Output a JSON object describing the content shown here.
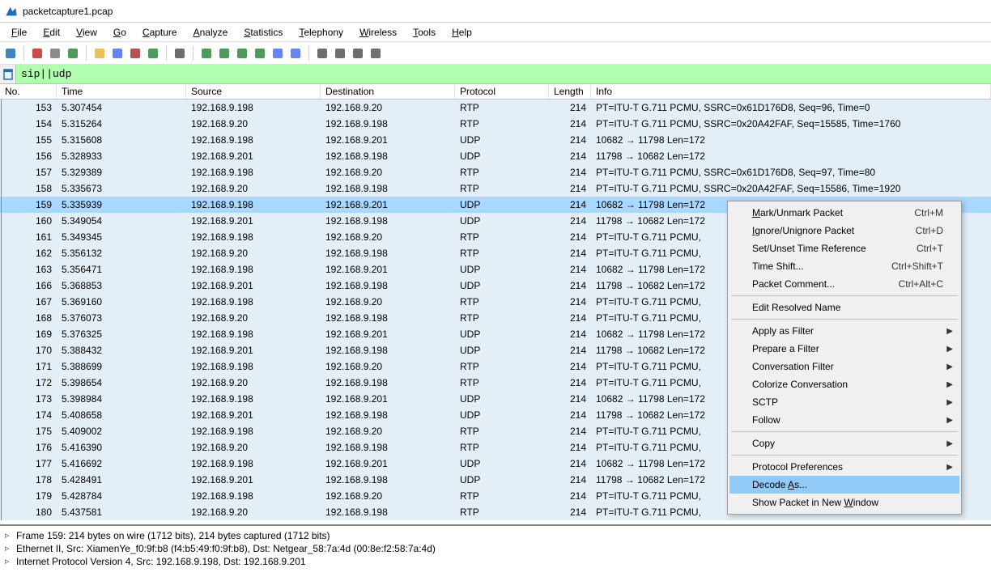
{
  "window": {
    "title": "packetcapture1.pcap"
  },
  "menu": {
    "items": [
      "File",
      "Edit",
      "View",
      "Go",
      "Capture",
      "Analyze",
      "Statistics",
      "Telephony",
      "Wireless",
      "Tools",
      "Help"
    ]
  },
  "filter": {
    "value": "sip||udp"
  },
  "columns": {
    "no": "No.",
    "time": "Time",
    "src": "Source",
    "dst": "Destination",
    "proto": "Protocol",
    "len": "Length",
    "info": "Info"
  },
  "packets": [
    {
      "no": "153",
      "time": "5.307454",
      "src": "192.168.9.198",
      "dst": "192.168.9.20",
      "proto": "RTP",
      "len": "214",
      "info": "PT=ITU-T G.711 PCMU, SSRC=0x61D176D8, Seq=96, Time=0",
      "bg": "#e4eef7"
    },
    {
      "no": "154",
      "time": "5.315264",
      "src": "192.168.9.20",
      "dst": "192.168.9.198",
      "proto": "RTP",
      "len": "214",
      "info": "PT=ITU-T G.711 PCMU, SSRC=0x20A42FAF, Seq=15585, Time=1760",
      "bg": "#e4eef7"
    },
    {
      "no": "155",
      "time": "5.315608",
      "src": "192.168.9.198",
      "dst": "192.168.9.201",
      "proto": "UDP",
      "len": "214",
      "info": "10682 → 11798 Len=172",
      "bg": "#e4eef7"
    },
    {
      "no": "156",
      "time": "5.328933",
      "src": "192.168.9.201",
      "dst": "192.168.9.198",
      "proto": "UDP",
      "len": "214",
      "info": "11798 → 10682 Len=172",
      "bg": "#e4eef7"
    },
    {
      "no": "157",
      "time": "5.329389",
      "src": "192.168.9.198",
      "dst": "192.168.9.20",
      "proto": "RTP",
      "len": "214",
      "info": "PT=ITU-T G.711 PCMU, SSRC=0x61D176D8, Seq=97, Time=80",
      "bg": "#e4eef7"
    },
    {
      "no": "158",
      "time": "5.335673",
      "src": "192.168.9.20",
      "dst": "192.168.9.198",
      "proto": "RTP",
      "len": "214",
      "info": "PT=ITU-T G.711 PCMU, SSRC=0x20A42FAF, Seq=15586, Time=1920",
      "bg": "#e4eef7"
    },
    {
      "no": "159",
      "time": "5.335939",
      "src": "192.168.9.198",
      "dst": "192.168.9.201",
      "proto": "UDP",
      "len": "214",
      "info": "10682 → 11798 Len=172",
      "bg": "#a8d8ff",
      "selected": true
    },
    {
      "no": "160",
      "time": "5.349054",
      "src": "192.168.9.201",
      "dst": "192.168.9.198",
      "proto": "UDP",
      "len": "214",
      "info": "11798 → 10682 Len=172",
      "bg": "#e4eef7"
    },
    {
      "no": "161",
      "time": "5.349345",
      "src": "192.168.9.198",
      "dst": "192.168.9.20",
      "proto": "RTP",
      "len": "214",
      "info": "PT=ITU-T G.711 PCMU,",
      "bg": "#e4eef7"
    },
    {
      "no": "162",
      "time": "5.356132",
      "src": "192.168.9.20",
      "dst": "192.168.9.198",
      "proto": "RTP",
      "len": "214",
      "info": "PT=ITU-T G.711 PCMU,",
      "bg": "#e4eef7"
    },
    {
      "no": "163",
      "time": "5.356471",
      "src": "192.168.9.198",
      "dst": "192.168.9.201",
      "proto": "UDP",
      "len": "214",
      "info": "10682 → 11798 Len=172",
      "bg": "#e4eef7"
    },
    {
      "no": "166",
      "time": "5.368853",
      "src": "192.168.9.201",
      "dst": "192.168.9.198",
      "proto": "UDP",
      "len": "214",
      "info": "11798 → 10682 Len=172",
      "bg": "#e4eef7"
    },
    {
      "no": "167",
      "time": "5.369160",
      "src": "192.168.9.198",
      "dst": "192.168.9.20",
      "proto": "RTP",
      "len": "214",
      "info": "PT=ITU-T G.711 PCMU,",
      "bg": "#e4eef7"
    },
    {
      "no": "168",
      "time": "5.376073",
      "src": "192.168.9.20",
      "dst": "192.168.9.198",
      "proto": "RTP",
      "len": "214",
      "info": "PT=ITU-T G.711 PCMU,",
      "bg": "#e4eef7"
    },
    {
      "no": "169",
      "time": "5.376325",
      "src": "192.168.9.198",
      "dst": "192.168.9.201",
      "proto": "UDP",
      "len": "214",
      "info": "10682 → 11798 Len=172",
      "bg": "#e4eef7"
    },
    {
      "no": "170",
      "time": "5.388432",
      "src": "192.168.9.201",
      "dst": "192.168.9.198",
      "proto": "UDP",
      "len": "214",
      "info": "11798 → 10682 Len=172",
      "bg": "#e4eef7"
    },
    {
      "no": "171",
      "time": "5.388699",
      "src": "192.168.9.198",
      "dst": "192.168.9.20",
      "proto": "RTP",
      "len": "214",
      "info": "PT=ITU-T G.711 PCMU,",
      "bg": "#e4eef7"
    },
    {
      "no": "172",
      "time": "5.398654",
      "src": "192.168.9.20",
      "dst": "192.168.9.198",
      "proto": "RTP",
      "len": "214",
      "info": "PT=ITU-T G.711 PCMU,",
      "bg": "#e4eef7"
    },
    {
      "no": "173",
      "time": "5.398984",
      "src": "192.168.9.198",
      "dst": "192.168.9.201",
      "proto": "UDP",
      "len": "214",
      "info": "10682 → 11798 Len=172",
      "bg": "#e4eef7"
    },
    {
      "no": "174",
      "time": "5.408658",
      "src": "192.168.9.201",
      "dst": "192.168.9.198",
      "proto": "UDP",
      "len": "214",
      "info": "11798 → 10682 Len=172",
      "bg": "#e4eef7"
    },
    {
      "no": "175",
      "time": "5.409002",
      "src": "192.168.9.198",
      "dst": "192.168.9.20",
      "proto": "RTP",
      "len": "214",
      "info": "PT=ITU-T G.711 PCMU,",
      "bg": "#e4eef7"
    },
    {
      "no": "176",
      "time": "5.416390",
      "src": "192.168.9.20",
      "dst": "192.168.9.198",
      "proto": "RTP",
      "len": "214",
      "info": "PT=ITU-T G.711 PCMU,",
      "bg": "#e4eef7"
    },
    {
      "no": "177",
      "time": "5.416692",
      "src": "192.168.9.198",
      "dst": "192.168.9.201",
      "proto": "UDP",
      "len": "214",
      "info": "10682 → 11798 Len=172",
      "bg": "#e4eef7"
    },
    {
      "no": "178",
      "time": "5.428491",
      "src": "192.168.9.201",
      "dst": "192.168.9.198",
      "proto": "UDP",
      "len": "214",
      "info": "11798 → 10682 Len=172",
      "bg": "#e4eef7"
    },
    {
      "no": "179",
      "time": "5.428784",
      "src": "192.168.9.198",
      "dst": "192.168.9.20",
      "proto": "RTP",
      "len": "214",
      "info": "PT=ITU-T G.711 PCMU,",
      "bg": "#e4eef7"
    },
    {
      "no": "180",
      "time": "5.437581",
      "src": "192.168.9.20",
      "dst": "192.168.9.198",
      "proto": "RTP",
      "len": "214",
      "info": "PT=ITU-T G.711 PCMU,",
      "bg": "#e4eef7"
    }
  ],
  "details": [
    "Frame 159: 214 bytes on wire (1712 bits), 214 bytes captured (1712 bits)",
    "Ethernet II, Src: XiamenYe_f0:9f:b8 (f4:b5:49:f0:9f:b8), Dst: Netgear_58:7a:4d (00:8e:f2:58:7a:4d)",
    "Internet Protocol Version 4, Src: 192.168.9.198, Dst: 192.168.9.201"
  ],
  "context_menu": [
    {
      "type": "item",
      "label": "Mark/Unmark Packet",
      "shortcut": "Ctrl+M",
      "u": 0
    },
    {
      "type": "item",
      "label": "Ignore/Unignore Packet",
      "shortcut": "Ctrl+D",
      "u": 0
    },
    {
      "type": "item",
      "label": "Set/Unset Time Reference",
      "shortcut": "Ctrl+T"
    },
    {
      "type": "item",
      "label": "Time Shift...",
      "shortcut": "Ctrl+Shift+T"
    },
    {
      "type": "item",
      "label": "Packet Comment...",
      "shortcut": "Ctrl+Alt+C"
    },
    {
      "type": "sep"
    },
    {
      "type": "item",
      "label": "Edit Resolved Name"
    },
    {
      "type": "sep"
    },
    {
      "type": "item",
      "label": "Apply as Filter",
      "submenu": true
    },
    {
      "type": "item",
      "label": "Prepare a Filter",
      "submenu": true
    },
    {
      "type": "item",
      "label": "Conversation Filter",
      "submenu": true
    },
    {
      "type": "item",
      "label": "Colorize Conversation",
      "submenu": true
    },
    {
      "type": "item",
      "label": "SCTP",
      "submenu": true
    },
    {
      "type": "item",
      "label": "Follow",
      "submenu": true
    },
    {
      "type": "sep"
    },
    {
      "type": "item",
      "label": "Copy",
      "submenu": true
    },
    {
      "type": "sep"
    },
    {
      "type": "item",
      "label": "Protocol Preferences",
      "submenu": true
    },
    {
      "type": "item",
      "label": "Decode As...",
      "highlight": true,
      "u": 7
    },
    {
      "type": "item",
      "label": "Show Packet in New Window",
      "u": 19
    }
  ],
  "toolbar_icons": [
    "shark-fin-icon",
    "circle-record-icon",
    "stop-icon",
    "restart-icon",
    "folder-open-icon",
    "save-icon",
    "close-icon",
    "reload-icon",
    "search-icon",
    "arrow-left-icon",
    "arrow-right-icon",
    "jump-first-icon",
    "jump-last-icon",
    "autoscroll-icon",
    "colorize-icon",
    "zoom-in-icon",
    "zoom-out-icon",
    "zoom-reset-icon",
    "resize-columns-icon"
  ]
}
